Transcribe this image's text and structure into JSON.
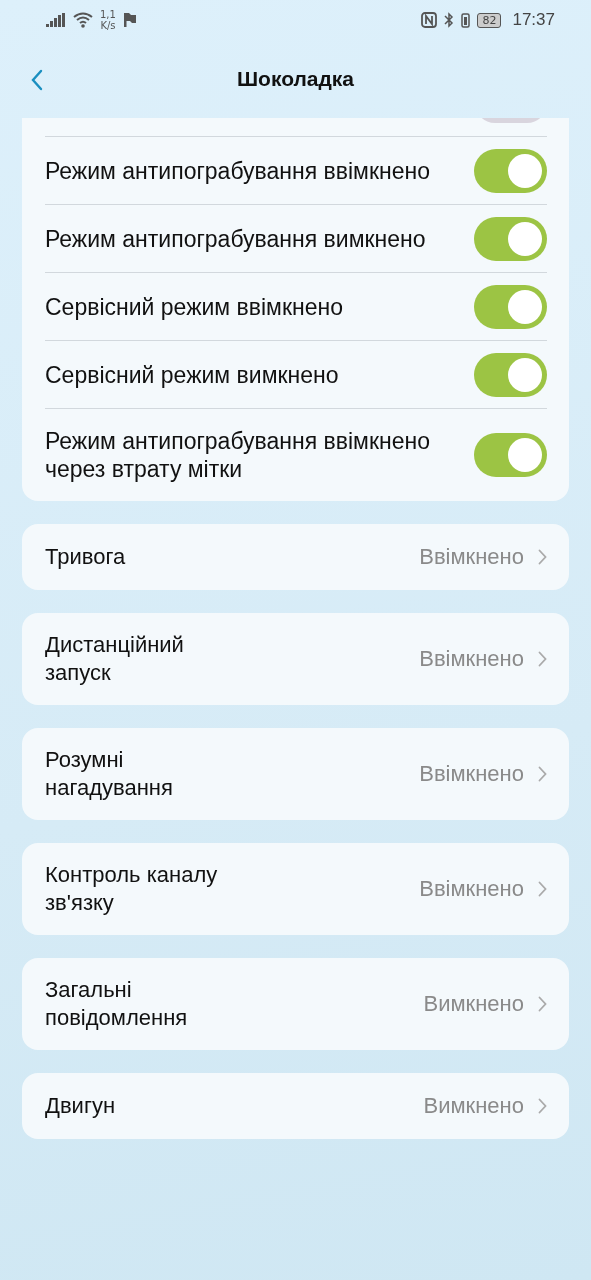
{
  "status_bar": {
    "speed_value": "1,1",
    "speed_unit": "K/s",
    "battery": "82",
    "time": "17:37"
  },
  "header": {
    "title": "Шоколадка"
  },
  "partial_toggle": {
    "on": false
  },
  "toggles": [
    {
      "label": "Режим антипограбування ввімкнено",
      "on": true
    },
    {
      "label": "Режим антипограбування вимкнено",
      "on": true
    },
    {
      "label": "Сервісний режим ввімкнено",
      "on": true
    },
    {
      "label": "Сервісний режим вимкнено",
      "on": true
    },
    {
      "label": "Режим антипограбування ввімкнено через втрату мітки",
      "on": true
    }
  ],
  "settings": [
    {
      "label": "Тривога",
      "value": "Ввімкнено"
    },
    {
      "label": "Дистанційний запуск",
      "value": "Ввімкнено"
    },
    {
      "label": "Розумні нагадування",
      "value": "Ввімкнено"
    },
    {
      "label": "Контроль каналу зв'язку",
      "value": "Ввімкнено"
    },
    {
      "label": "Загальні повідомлення",
      "value": "Вимкнено"
    },
    {
      "label": "Двигун",
      "value": "Вимкнено"
    }
  ]
}
